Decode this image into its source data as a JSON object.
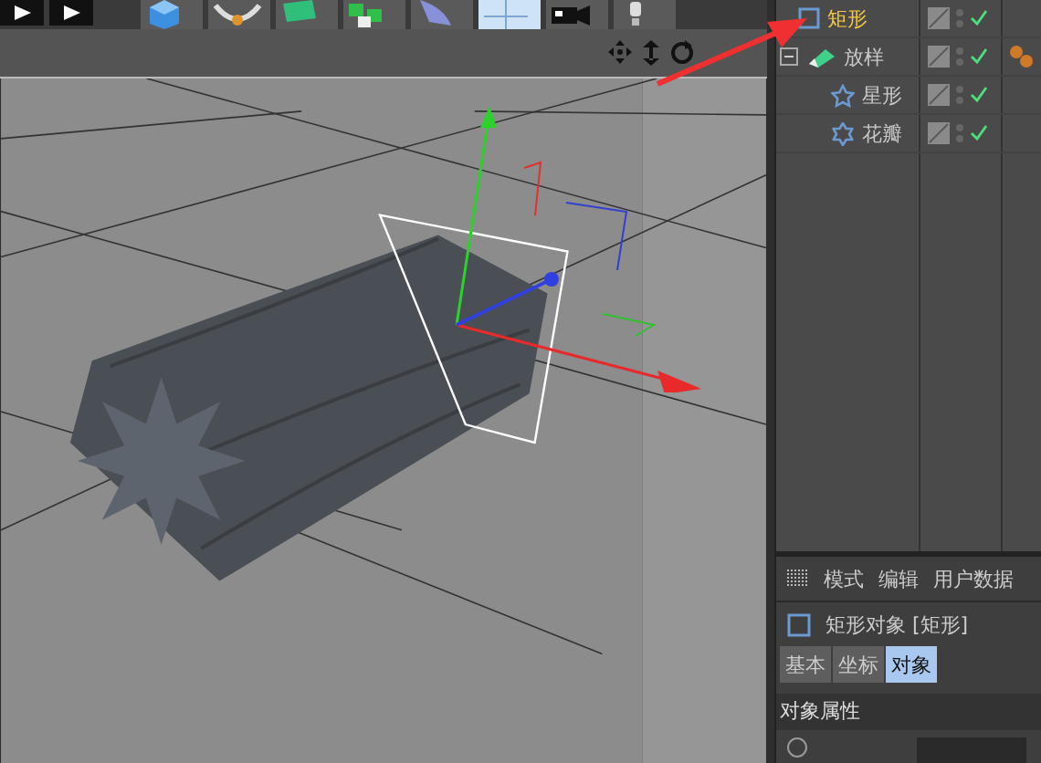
{
  "objects": [
    {
      "name": "矩形",
      "kind": "rectangle",
      "selected": true,
      "enabled": true,
      "tagged": false
    },
    {
      "name": "放样",
      "kind": "loft",
      "selected": false,
      "enabled": true,
      "tagged": true,
      "expanded": true,
      "children": [
        {
          "name": "星形",
          "kind": "star",
          "selected": false,
          "enabled": true,
          "tagged": false
        },
        {
          "name": "花瓣",
          "kind": "flower",
          "selected": false,
          "enabled": true,
          "tagged": false
        }
      ]
    }
  ],
  "attributes": {
    "menu": [
      "模式",
      "编辑",
      "用户数据"
    ],
    "object_title": "矩形对象 [矩形]",
    "tabs": [
      {
        "label": "基本",
        "selected": false
      },
      {
        "label": "坐标",
        "selected": false
      },
      {
        "label": "对象",
        "selected": true
      }
    ],
    "section": "对象属性",
    "cut_row": {
      "selected": false
    }
  }
}
